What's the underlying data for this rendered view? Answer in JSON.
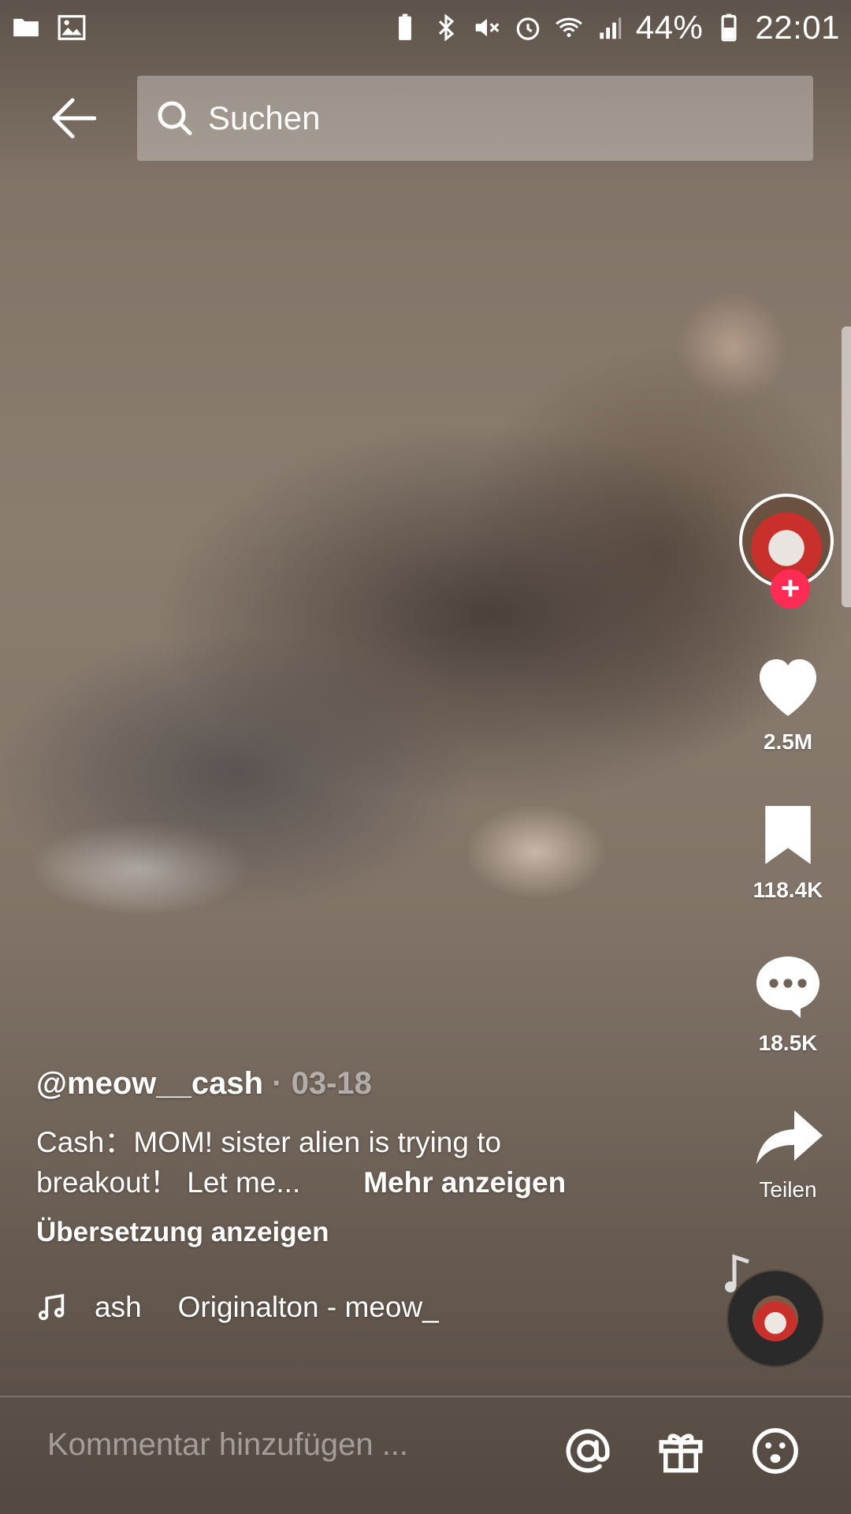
{
  "status_bar": {
    "battery_percent": "44%",
    "time": "22:01",
    "icons_left": [
      "folder-icon",
      "image-icon"
    ],
    "icons_right": [
      "battery-saver-icon",
      "bluetooth-icon",
      "mute-icon",
      "alarm-icon",
      "wifi-icon",
      "signal-icon",
      "battery-icon"
    ]
  },
  "header": {
    "search_placeholder": "Suchen"
  },
  "post": {
    "author": "@meow__cash",
    "date": "· 03-18",
    "description": "Cash：MOM! sister alien is trying to breakout！ Let me...",
    "more_label": "Mehr anzeigen",
    "translate_label": "Übersetzung anzeigen",
    "music_title": "ash",
    "music_subtitle": "Originalton - meow_"
  },
  "actions": {
    "likes": "2.5M",
    "saves": "118.4K",
    "comments": "18.5K",
    "share_label": "Teilen"
  },
  "comment_bar": {
    "placeholder": "Kommentar hinzufügen ..."
  },
  "colors": {
    "accent": "#fe2c55"
  }
}
